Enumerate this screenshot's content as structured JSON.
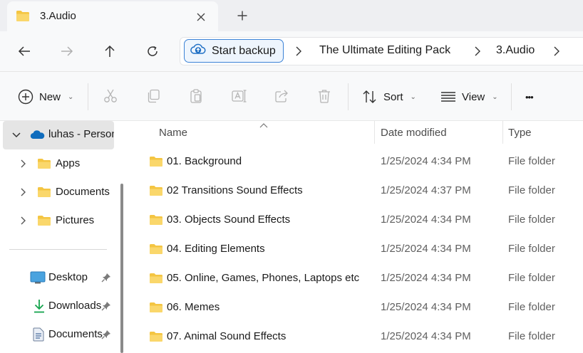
{
  "tab": {
    "title": "3.Audio",
    "icon": "folder-icon"
  },
  "address": {
    "backup_label": "Start backup",
    "crumbs": [
      "The Ultimate Editing Pack",
      "3.Audio"
    ]
  },
  "toolbar": {
    "new_label": "New",
    "sort_label": "Sort",
    "view_label": "View",
    "more_label": "•••"
  },
  "sidebar": {
    "onedrive_label": "luhas - Personal",
    "tree_items": [
      {
        "label": "Apps"
      },
      {
        "label": "Documents"
      },
      {
        "label": "Pictures"
      }
    ],
    "quick_access": [
      {
        "label": "Desktop",
        "icon": "desktop-icon"
      },
      {
        "label": "Downloads",
        "icon": "download-icon"
      },
      {
        "label": "Documents",
        "icon": "document-icon"
      }
    ]
  },
  "columns": {
    "name": "Name",
    "date": "Date modified",
    "type": "Type"
  },
  "files": [
    {
      "name": "01. Background",
      "date": "1/25/2024 4:34 PM",
      "type": "File folder"
    },
    {
      "name": "02 Transitions Sound Effects",
      "date": "1/25/2024 4:37 PM",
      "type": "File folder"
    },
    {
      "name": "03. Objects Sound Effects",
      "date": "1/25/2024 4:34 PM",
      "type": "File folder"
    },
    {
      "name": "04. Editing Elements",
      "date": "1/25/2024 4:34 PM",
      "type": "File folder"
    },
    {
      "name": "05. Online, Games, Phones, Laptops etc",
      "date": "1/25/2024 4:34 PM",
      "type": "File folder"
    },
    {
      "name": "06. Memes",
      "date": "1/25/2024 4:34 PM",
      "type": "File folder"
    },
    {
      "name": "07. Animal Sound Effects",
      "date": "1/25/2024 4:34 PM",
      "type": "File folder"
    }
  ],
  "colors": {
    "accent": "#3b82d6",
    "folder": "#f4c542",
    "selected_bg": "#e5e5e5"
  }
}
